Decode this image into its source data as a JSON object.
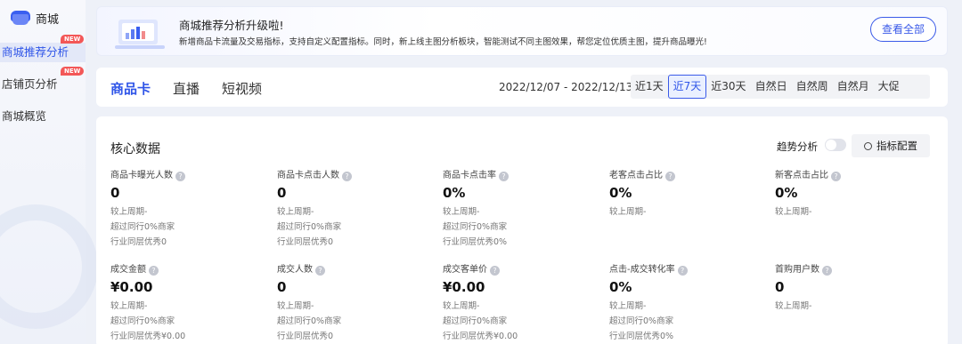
{
  "sidebar": {
    "title": "商城",
    "items": [
      {
        "label": "商城推荐分析",
        "badge": "NEW",
        "active": true
      },
      {
        "label": "店铺页分析",
        "badge": "NEW",
        "active": false
      },
      {
        "label": "商城概览",
        "badge": "",
        "active": false
      }
    ]
  },
  "banner": {
    "title": "商城推荐分析升级啦!",
    "description": "新增商品卡流量及交易指标，支持自定义配置指标。同时，新上线主图分析板块，智能测试不同主图效果，帮您定位优质主图，提升商品曝光!",
    "button": "查看全部"
  },
  "tabs": [
    "商品卡",
    "直播",
    "短视频"
  ],
  "date_range": "2022/12/07 - 2022/12/13",
  "periods": [
    "近1天",
    "近7天",
    "近30天",
    "自然日",
    "自然周",
    "自然月",
    "大促"
  ],
  "active_period": "近7天",
  "core": {
    "title": "核心数据",
    "trend_label": "趋势分析",
    "config_button": "指标配置",
    "help_glyph": "?"
  },
  "metrics": [
    {
      "label": "商品卡曝光人数",
      "value": "0",
      "subs": [
        "较上周期-",
        "超过同行0%商家",
        "行业同层优秀0"
      ]
    },
    {
      "label": "商品卡点击人数",
      "value": "0",
      "subs": [
        "较上周期-",
        "超过同行0%商家",
        "行业同层优秀0"
      ]
    },
    {
      "label": "商品卡点击率",
      "value": "0%",
      "subs": [
        "较上周期-",
        "超过同行0%商家",
        "行业同层优秀0%"
      ]
    },
    {
      "label": "老客点击占比",
      "value": "0%",
      "subs": [
        "较上周期-"
      ]
    },
    {
      "label": "新客点击占比",
      "value": "0%",
      "subs": [
        "较上周期-"
      ]
    },
    {
      "label": "成交金额",
      "value": "¥0.00",
      "subs": [
        "较上周期-",
        "超过同行0%商家",
        "行业同层优秀¥0.00"
      ]
    },
    {
      "label": "成交人数",
      "value": "0",
      "subs": [
        "较上周期-",
        "超过同行0%商家",
        "行业同层优秀0"
      ]
    },
    {
      "label": "成交客单价",
      "value": "¥0.00",
      "subs": [
        "较上周期-",
        "超过同行0%商家",
        "行业同层优秀¥0.00"
      ]
    },
    {
      "label": "点击-成交转化率",
      "value": "0%",
      "subs": [
        "较上周期-",
        "超过同行0%商家",
        "行业同层优秀0%"
      ]
    },
    {
      "label": "首购用户数",
      "value": "0",
      "subs": [
        "较上周期-"
      ]
    }
  ],
  "colors": {
    "accent": "#2f55e8",
    "badge": "#f35757",
    "background": "#eef1f8"
  }
}
